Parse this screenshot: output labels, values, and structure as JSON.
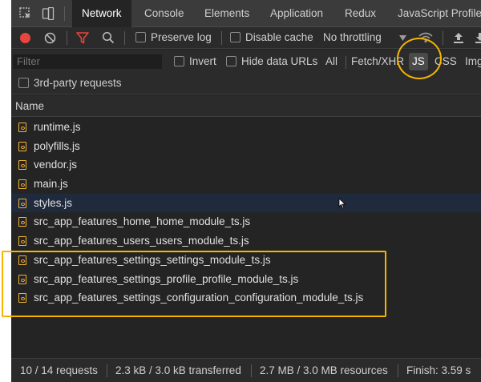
{
  "tabs": [
    {
      "label": "Network",
      "active": true
    },
    {
      "label": "Console"
    },
    {
      "label": "Elements"
    },
    {
      "label": "Application"
    },
    {
      "label": "Redux"
    },
    {
      "label": "JavaScript Profile"
    }
  ],
  "toolbar": {
    "preserve_log": "Preserve log",
    "disable_cache": "Disable cache",
    "throttling": "No throttling",
    "record_color": "#e8453c",
    "filter_color": "#e8453c"
  },
  "filter": {
    "placeholder": "Filter",
    "invert": "Invert",
    "hide_data_urls": "Hide data URLs",
    "types": [
      {
        "label": "All"
      },
      {
        "label": "Fetch/XHR"
      },
      {
        "label": "JS",
        "selected": true
      },
      {
        "label": "CSS"
      },
      {
        "label": "Img"
      }
    ],
    "third_party": "3rd-party requests"
  },
  "table": {
    "column_name": "Name",
    "rows": [
      {
        "name": "runtime.js"
      },
      {
        "name": "polyfills.js"
      },
      {
        "name": "vendor.js"
      },
      {
        "name": "main.js"
      },
      {
        "name": "styles.js",
        "selected": true
      },
      {
        "name": "src_app_features_home_home_module_ts.js"
      },
      {
        "name": "src_app_features_users_users_module_ts.js"
      },
      {
        "name": "src_app_features_settings_settings_module_ts.js"
      },
      {
        "name": "src_app_features_settings_profile_profile_module_ts.js"
      },
      {
        "name": "src_app_features_settings_configuration_configuration_module_ts.js"
      }
    ]
  },
  "status": {
    "requests": "10 / 14 requests",
    "transferred": "2.3 kB / 3.0 kB transferred",
    "resources": "2.7 MB / 3.0 MB resources",
    "finish": "Finish: 3.59 s"
  },
  "colors": {
    "annotation": "#f5b400",
    "file_icon": "#f2b233",
    "panel_bg": "#242424"
  }
}
